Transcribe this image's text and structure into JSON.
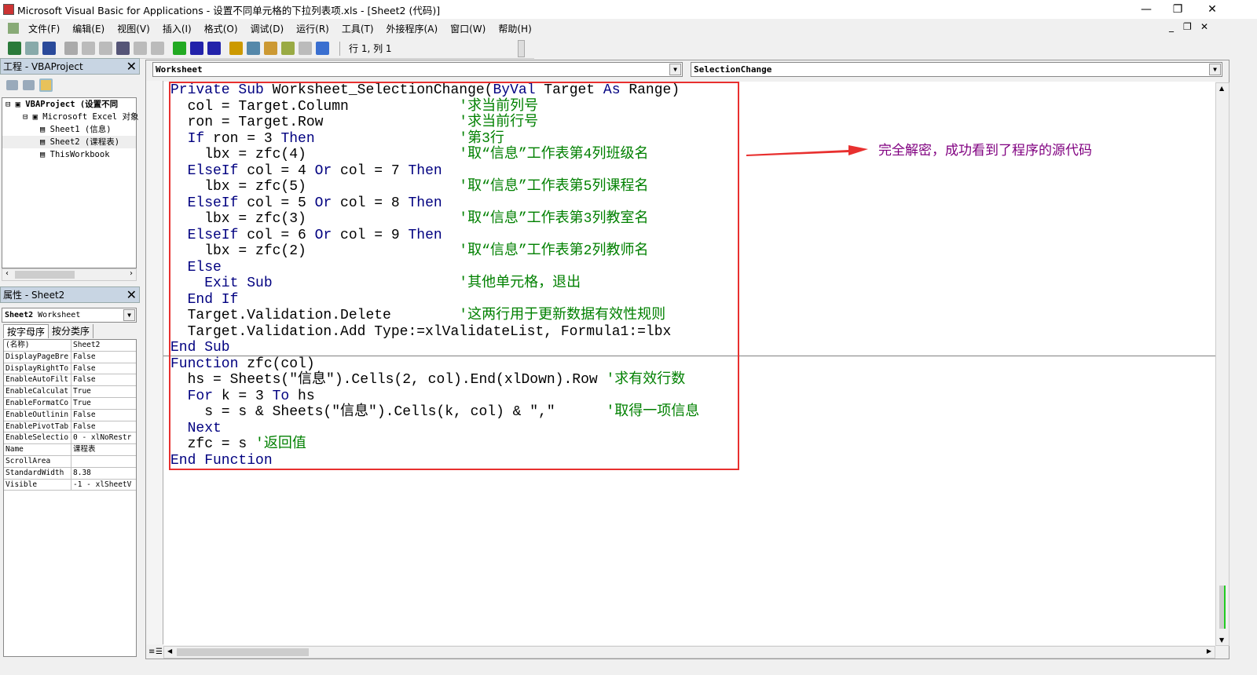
{
  "window": {
    "title": "Microsoft Visual Basic for Applications - 设置不同单元格的下拉列表项.xls - [Sheet2 (代码)]"
  },
  "menu": [
    "文件(F)",
    "编辑(E)",
    "视图(V)",
    "插入(I)",
    "格式(O)",
    "调试(D)",
    "运行(R)",
    "工具(T)",
    "外接程序(A)",
    "窗口(W)",
    "帮助(H)"
  ],
  "toolbar": {
    "position": "行 1, 列 1",
    "icons": [
      "excel-icon",
      "insert-userform-icon",
      "save-icon",
      "cut-icon",
      "copy-icon",
      "paste-icon",
      "find-icon",
      "undo-icon",
      "redo-icon",
      "run-icon",
      "break-icon",
      "reset-icon",
      "design-mode-icon",
      "project-explorer-icon",
      "properties-icon",
      "object-browser-icon",
      "toolbox-icon",
      "help-icon"
    ]
  },
  "project": {
    "title": "工程 - VBAProject",
    "tree": [
      {
        "label": "VBAProject (设置不同",
        "level": 0,
        "bold": true
      },
      {
        "label": "Microsoft Excel 对象",
        "level": 1
      },
      {
        "label": "Sheet1 (信息)",
        "level": 2
      },
      {
        "label": "Sheet2 (课程表)",
        "level": 2
      },
      {
        "label": "ThisWorkbook",
        "level": 2
      }
    ]
  },
  "properties": {
    "title": "属性 - Sheet2",
    "object_bold": "Sheet2",
    "object_type": "Worksheet",
    "tabs": [
      "按字母序",
      "按分类序"
    ],
    "rows": [
      [
        "(名称)",
        "Sheet2"
      ],
      [
        "DisplayPageBre",
        "False"
      ],
      [
        "DisplayRightTo",
        "False"
      ],
      [
        "EnableAutoFilt",
        "False"
      ],
      [
        "EnableCalculat",
        "True"
      ],
      [
        "EnableFormatCo",
        "True"
      ],
      [
        "EnableOutlinin",
        "False"
      ],
      [
        "EnablePivotTab",
        "False"
      ],
      [
        "EnableSelectio",
        "0 - xlNoRestr"
      ],
      [
        "Name",
        "课程表"
      ],
      [
        "ScrollArea",
        ""
      ],
      [
        "StandardWidth",
        "8.38"
      ],
      [
        "Visible",
        "-1 - xlSheetV"
      ]
    ]
  },
  "editor": {
    "object_combo": "Worksheet",
    "procedure_combo": "SelectionChange",
    "colors": {
      "keyword": "#000080",
      "comment": "#008000",
      "text": "#000000"
    },
    "lines": [
      [
        [
          "k",
          "Private Sub "
        ],
        [
          "t",
          "Worksheet_SelectionChange("
        ],
        [
          "k",
          "ByVal "
        ],
        [
          "t",
          "Target "
        ],
        [
          "k",
          "As "
        ],
        [
          "t",
          "Range)"
        ]
      ],
      [
        [
          "t",
          "  col = Target.Column             "
        ],
        [
          "c",
          "'求当前列号"
        ]
      ],
      [
        [
          "t",
          "  ron = Target.Row                "
        ],
        [
          "c",
          "'求当前行号"
        ]
      ],
      [
        [
          "k",
          "  If "
        ],
        [
          "t",
          "ron = 3 "
        ],
        [
          "k",
          "Then"
        ],
        [
          "t",
          "                 "
        ],
        [
          "c",
          "'第3行"
        ]
      ],
      [
        [
          "t",
          "    lbx = zfc(4)                  "
        ],
        [
          "c",
          "'取“信息”工作表第4列班级名"
        ]
      ],
      [
        [
          "k",
          "  ElseIf "
        ],
        [
          "t",
          "col = 4 "
        ],
        [
          "k",
          "Or "
        ],
        [
          "t",
          "col = 7 "
        ],
        [
          "k",
          "Then"
        ]
      ],
      [
        [
          "t",
          "    lbx = zfc(5)                  "
        ],
        [
          "c",
          "'取“信息”工作表第5列课程名"
        ]
      ],
      [
        [
          "k",
          "  ElseIf "
        ],
        [
          "t",
          "col = 5 "
        ],
        [
          "k",
          "Or "
        ],
        [
          "t",
          "col = 8 "
        ],
        [
          "k",
          "Then"
        ]
      ],
      [
        [
          "t",
          "    lbx = zfc(3)                  "
        ],
        [
          "c",
          "'取“信息”工作表第3列教室名"
        ]
      ],
      [
        [
          "k",
          "  ElseIf "
        ],
        [
          "t",
          "col = 6 "
        ],
        [
          "k",
          "Or "
        ],
        [
          "t",
          "col = 9 "
        ],
        [
          "k",
          "Then"
        ]
      ],
      [
        [
          "t",
          "    lbx = zfc(2)                  "
        ],
        [
          "c",
          "'取“信息”工作表第2列教师名"
        ]
      ],
      [
        [
          "k",
          "  Else"
        ]
      ],
      [
        [
          "k",
          "    Exit Sub"
        ],
        [
          "t",
          "                      "
        ],
        [
          "c",
          "'其他单元格，退出"
        ]
      ],
      [
        [
          "k",
          "  End If"
        ]
      ],
      [
        [
          "t",
          "  Target.Validation.Delete        "
        ],
        [
          "c",
          "'这两行用于更新数据有效性规则"
        ]
      ],
      [
        [
          "t",
          "  Target.Validation.Add Type:=xlValidateList, Formula1:=lbx"
        ]
      ],
      [
        [
          "k",
          "End Sub"
        ]
      ],
      [
        [
          "k",
          "Function "
        ],
        [
          "t",
          "zfc(col)"
        ]
      ],
      [
        [
          "t",
          "  hs = Sheets(\"信息\").Cells(2, col).End(xlDown).Row "
        ],
        [
          "c",
          "'求有效行数"
        ]
      ],
      [
        [
          "k",
          "  For "
        ],
        [
          "t",
          "k = 3 "
        ],
        [
          "k",
          "To "
        ],
        [
          "t",
          "hs"
        ]
      ],
      [
        [
          "t",
          "    s = s & Sheets(\"信息\").Cells(k, col) & \",\"      "
        ],
        [
          "c",
          "'取得一项信息"
        ]
      ],
      [
        [
          "k",
          "  Next"
        ]
      ],
      [
        [
          "t",
          "  zfc = s "
        ],
        [
          "c",
          "'返回值"
        ]
      ],
      [
        [
          "k",
          "End Function"
        ]
      ]
    ]
  },
  "annotation": {
    "text": "完全解密，成功看到了程序的源代码",
    "color": "#800080",
    "highlight_color": "#e8302f"
  }
}
